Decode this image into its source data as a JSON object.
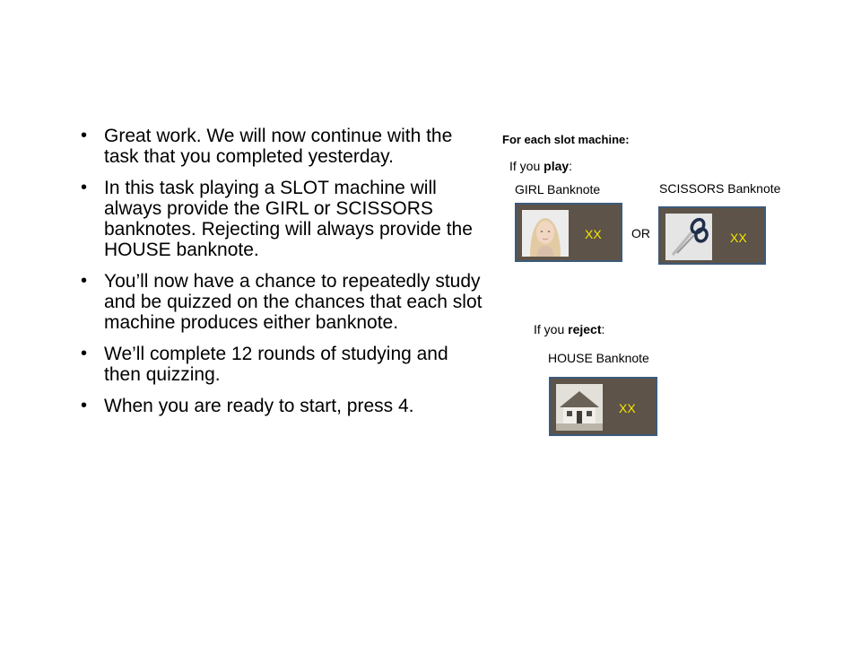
{
  "instructions": {
    "bullets": [
      "Great work. We will now continue with the task that you completed yesterday.",
      "In this task playing a SLOT machine will always provide the GIRL or SCISSORS banknotes. Rejecting will always provide the HOUSE banknote.",
      "You’ll now have a chance to repeatedly study and be quizzed on the chances that each slot machine produces either banknote.",
      "We’ll complete 12 rounds of studying and then quizzing.",
      "When you are ready to start, press 4."
    ]
  },
  "diagram": {
    "heading": "For each slot machine:",
    "play_prefix": "If you ",
    "play_word": "play",
    "play_suffix": ":",
    "reject_prefix": "If you ",
    "reject_word": "reject",
    "reject_suffix": ":",
    "or_label": "OR",
    "girl": {
      "title": "GIRL Banknote",
      "value": "XX"
    },
    "scissors": {
      "title": "SCISSORS Banknote",
      "value": "XX"
    },
    "house": {
      "title": "HOUSE Banknote",
      "value": "XX"
    },
    "colors": {
      "banknote_bg": "#5d5348",
      "banknote_border": "#3c5a7a",
      "value_text": "#f4e600"
    },
    "icons": [
      "girl-portrait-icon",
      "scissors-icon",
      "house-icon"
    ]
  }
}
